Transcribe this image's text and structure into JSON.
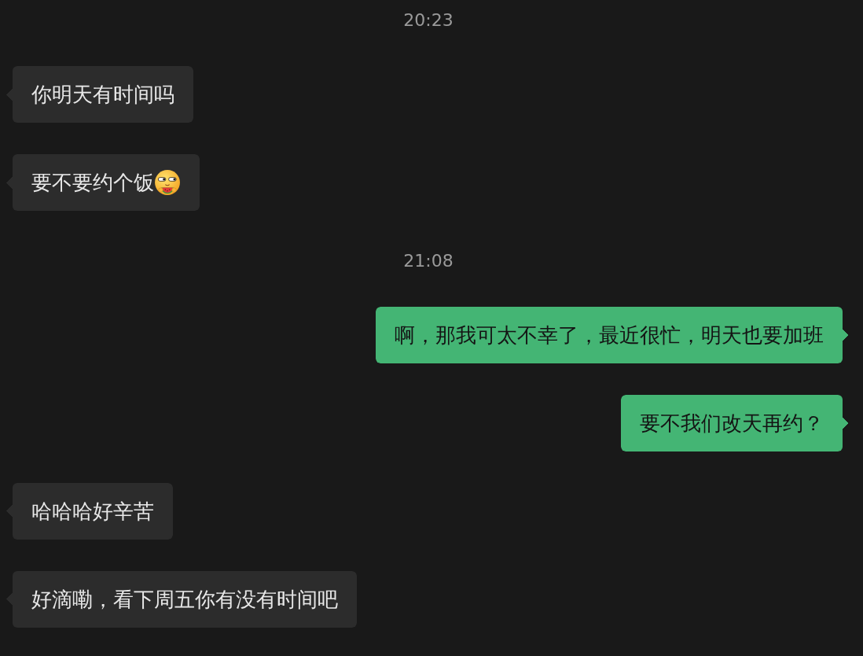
{
  "conversation": [
    {
      "time": "20:23",
      "messages": [
        {
          "kind": "received",
          "text": "你明天有时间吗",
          "emoji": false
        },
        {
          "kind": "received",
          "text": "要不要约个饭",
          "emoji": true
        }
      ]
    },
    {
      "time": "21:08",
      "messages": [
        {
          "kind": "sent",
          "text": "啊，那我可太不幸了，最近很忙，明天也要加班",
          "emoji": false
        },
        {
          "kind": "sent",
          "text": "要不我们改天再约？",
          "emoji": false
        },
        {
          "kind": "received",
          "text": "哈哈哈好辛苦",
          "emoji": false
        },
        {
          "kind": "received",
          "text": "好滴嘞，看下周五你有没有时间吧",
          "emoji": false
        }
      ]
    }
  ]
}
